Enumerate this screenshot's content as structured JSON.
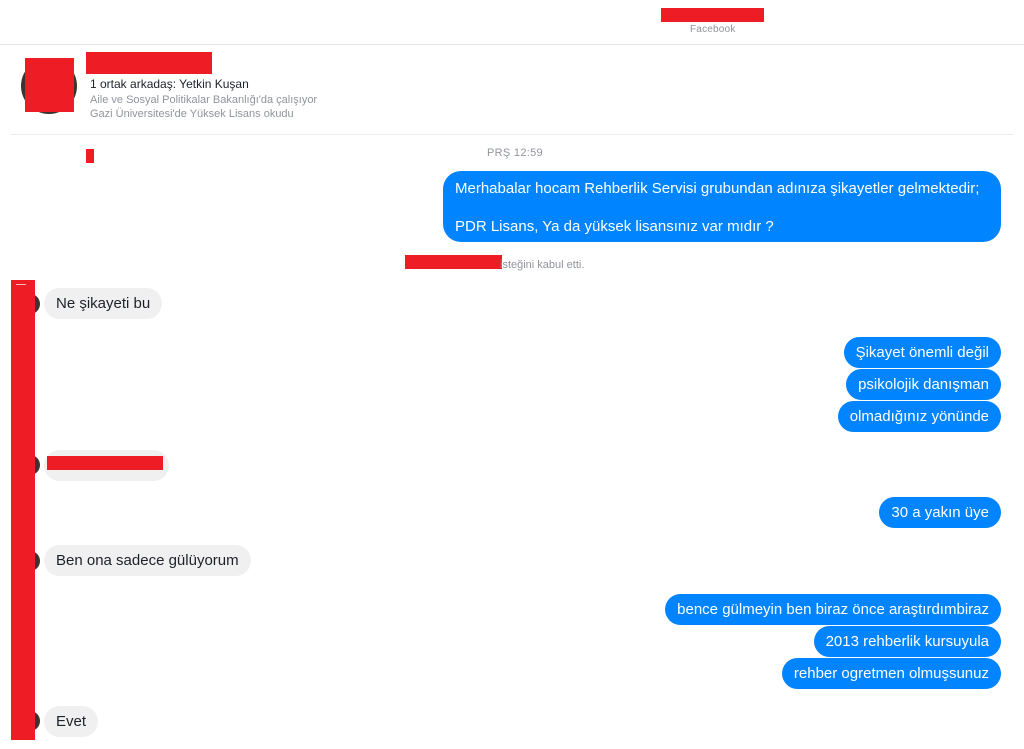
{
  "header": {
    "brand_label": "Facebook"
  },
  "profile": {
    "mutual_friend": "1 ortak arkadaş: Yetkin Kuşan",
    "work": "Aile ve Sosyal Politikalar Bakanlığı'da çalışıyor",
    "education": "Gazi Üniversitesi'de Yüksek Lisans okudu"
  },
  "conversation": {
    "timestamp": "PRŞ 12:59",
    "first_message": {
      "line1": "Merhabalar hocam Rehberlik Servisi grubundan adınıza şikayetler gelmektedir;",
      "line2": "PDR Lisans, Ya da yüksek lisansınız var mıdır ?"
    },
    "system_message": "isteğini kabul etti.",
    "incoming": [
      "Ne şikayeti bu",
      "Ben ona sadece gülüyorum",
      "Evet"
    ],
    "outgoing_group1": [
      "Şikayet önemli değil",
      "psikolojik danışman",
      "olmadığınız yönünde"
    ],
    "outgoing_single": "30 a yakın üye",
    "outgoing_group2": [
      "bence gülmeyin ben biraz önce araştırdımbiraz",
      "2013 rehberlik kursuyula",
      "rehber ogretmen olmuşsunuz"
    ]
  },
  "colors": {
    "outgoing_bubble": "#0084ff",
    "incoming_bubble": "#f1f0f0",
    "redaction": "#ee1c25"
  }
}
